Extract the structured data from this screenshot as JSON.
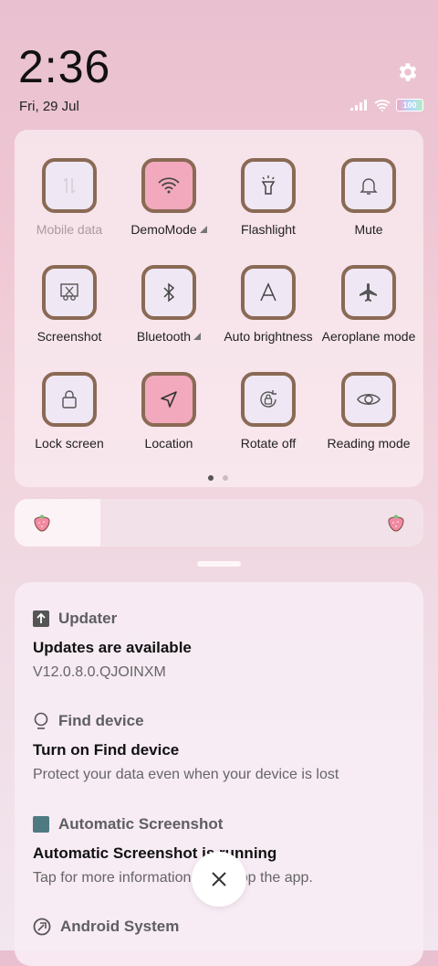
{
  "status_bar": {
    "time": "2:36",
    "date": "Fri, 29 Jul",
    "battery": "100"
  },
  "quick_settings": {
    "tiles": [
      {
        "label": "Mobile data",
        "icon": "mobile-data-icon",
        "active": false,
        "disabled": true
      },
      {
        "label": "DemoMode",
        "icon": "wifi-icon",
        "active": true,
        "expandable": true
      },
      {
        "label": "Flashlight",
        "icon": "flashlight-icon",
        "active": false
      },
      {
        "label": "Mute",
        "icon": "bell-icon",
        "active": false
      },
      {
        "label": "Screenshot",
        "icon": "scissors-icon",
        "active": false
      },
      {
        "label": "Bluetooth",
        "icon": "bluetooth-icon",
        "active": false,
        "expandable": true
      },
      {
        "label": "Auto brightness",
        "icon": "letter-a-icon",
        "active": false
      },
      {
        "label": "Aeroplane mode",
        "icon": "airplane-icon",
        "active": false
      },
      {
        "label": "Lock screen",
        "icon": "lock-icon",
        "active": false
      },
      {
        "label": "Location",
        "icon": "location-arrow-icon",
        "active": true
      },
      {
        "label": "Rotate off",
        "icon": "rotate-lock-icon",
        "active": false
      },
      {
        "label": "Reading mode",
        "icon": "eye-icon",
        "active": false
      }
    ],
    "page_indicator": {
      "pages": 2,
      "current": 1
    }
  },
  "brightness": {
    "level": 0.21
  },
  "notifications": [
    {
      "app": "Updater",
      "icon": "updater-icon",
      "title": "Updates are available",
      "text": "V12.0.8.0.QJOINXM"
    },
    {
      "app": "Find device",
      "icon": "find-device-icon",
      "title": "Turn on Find device",
      "text": "Protect your data even when your device is lost"
    },
    {
      "app": "Automatic Screenshot",
      "icon": "screenshot-app-icon",
      "title": "Automatic Screenshot is running",
      "text": "Tap for more information or to stop the app."
    },
    {
      "app": "Android System",
      "icon": "android-system-icon",
      "title": "",
      "text": ""
    }
  ],
  "colors": {
    "tile_border": "#8a6a55",
    "tile_active": "#f2a9bd",
    "tile_inactive": "#efe7f3"
  }
}
